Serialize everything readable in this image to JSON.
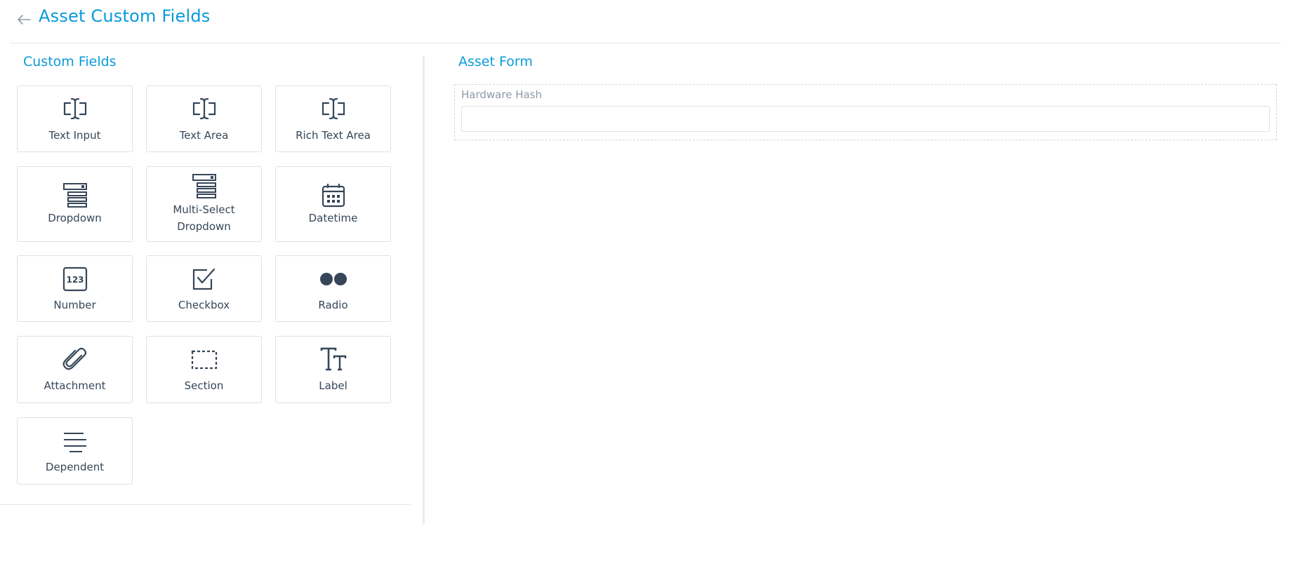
{
  "header": {
    "title": "Asset Custom Fields",
    "back_icon": "arrow-left-icon"
  },
  "left": {
    "title": "Custom Fields",
    "fields": [
      {
        "label": "Text Input",
        "icon": "text-cursor-icon"
      },
      {
        "label": "Text Area",
        "icon": "text-cursor-icon"
      },
      {
        "label": "Rich Text Area",
        "icon": "text-cursor-icon"
      },
      {
        "label": "Dropdown",
        "icon": "dropdown-list-icon"
      },
      {
        "label": "Multi-Select Dropdown",
        "icon": "dropdown-list-icon"
      },
      {
        "label": "Datetime",
        "icon": "calendar-icon"
      },
      {
        "label": "Number",
        "icon": "number-123-icon"
      },
      {
        "label": "Checkbox",
        "icon": "checkbox-icon"
      },
      {
        "label": "Radio",
        "icon": "radio-dots-icon"
      },
      {
        "label": "Attachment",
        "icon": "paperclip-icon"
      },
      {
        "label": "Section",
        "icon": "dashed-section-icon"
      },
      {
        "label": "Label",
        "icon": "text-size-icon"
      },
      {
        "label": "Dependent",
        "icon": "lines-icon"
      }
    ]
  },
  "right": {
    "title": "Asset Form",
    "form_fields": [
      {
        "label": "Hardware Hash",
        "value": ""
      }
    ]
  },
  "colors": {
    "accent": "#0a9ad9",
    "text": "#364658",
    "muted": "#8f9aa6",
    "border": "#dde1e6"
  }
}
